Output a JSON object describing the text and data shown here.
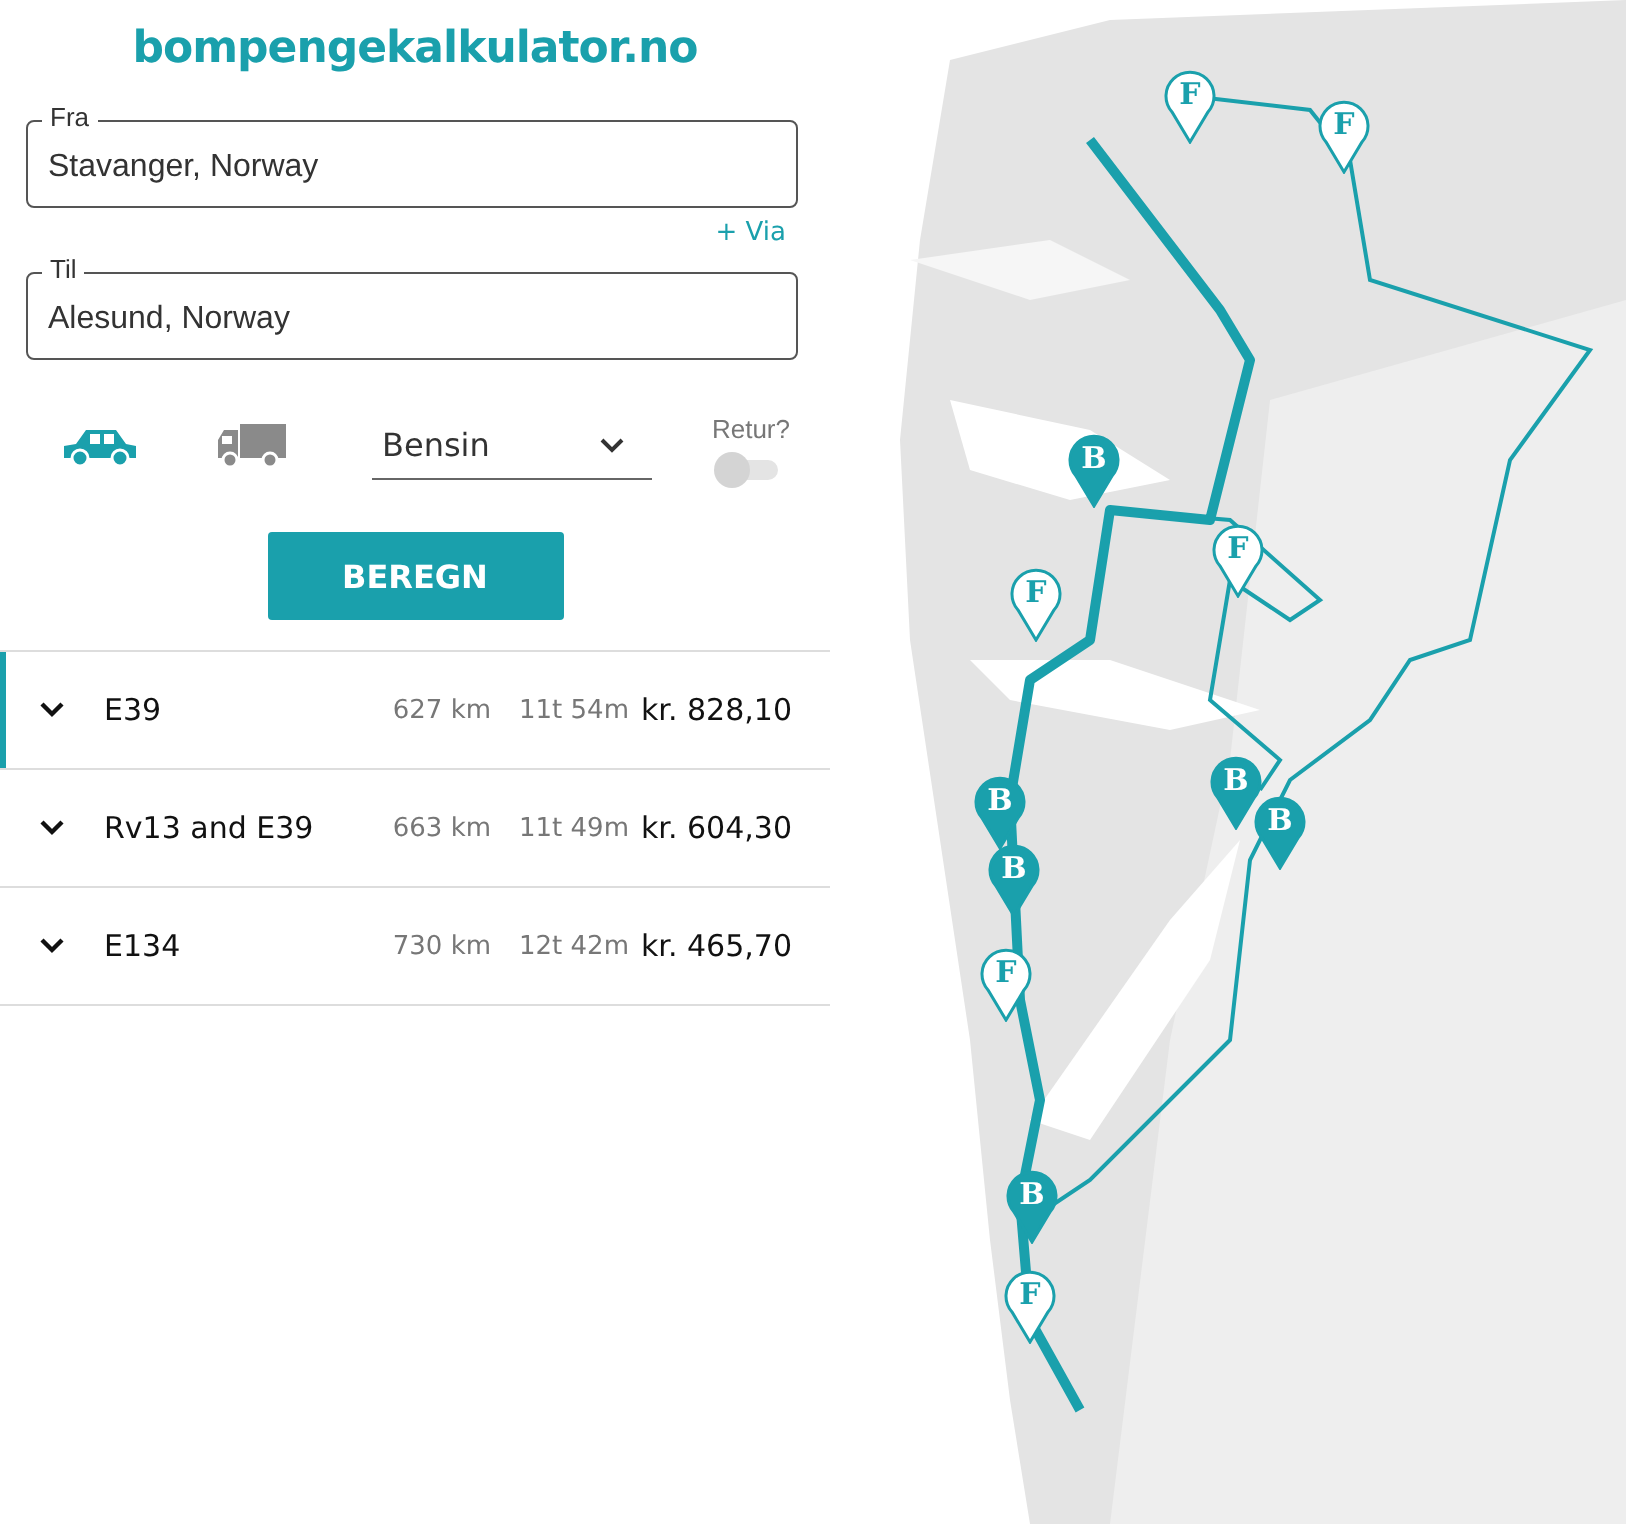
{
  "logo": "bompengekalkulator.no",
  "from": {
    "label": "Fra",
    "value": "Stavanger, Norway"
  },
  "via_link": "+ Via",
  "to": {
    "label": "Til",
    "value": "Alesund, Norway"
  },
  "vehicles": [
    {
      "kind": "car",
      "selected": true
    },
    {
      "kind": "truck",
      "selected": false
    }
  ],
  "fuel": {
    "value": "Bensin"
  },
  "return_trip": {
    "label": "Retur?",
    "on": false
  },
  "calculate_button": "BEREGN",
  "routes": [
    {
      "name": "E39",
      "distance": "627 km",
      "duration": "11t 54m",
      "price": "kr. 828,10",
      "selected": true
    },
    {
      "name": "Rv13 and E39",
      "distance": "663 km",
      "duration": "11t 49m",
      "price": "kr. 604,30",
      "selected": false
    },
    {
      "name": "E134",
      "distance": "730 km",
      "duration": "12t 42m",
      "price": "kr. 465,70",
      "selected": false
    }
  ],
  "map": {
    "kind": "picture",
    "markers": [
      {
        "label": "F",
        "filled": false
      },
      {
        "label": "F",
        "filled": false
      },
      {
        "label": "B",
        "filled": true
      },
      {
        "label": "F",
        "filled": false
      },
      {
        "label": "F",
        "filled": false
      },
      {
        "label": "B",
        "filled": true
      },
      {
        "label": "B",
        "filled": true
      },
      {
        "label": "B",
        "filled": true
      },
      {
        "label": "B",
        "filled": true
      },
      {
        "label": "F",
        "filled": false
      },
      {
        "label": "B",
        "filled": true
      },
      {
        "label": "F",
        "filled": false
      }
    ]
  }
}
